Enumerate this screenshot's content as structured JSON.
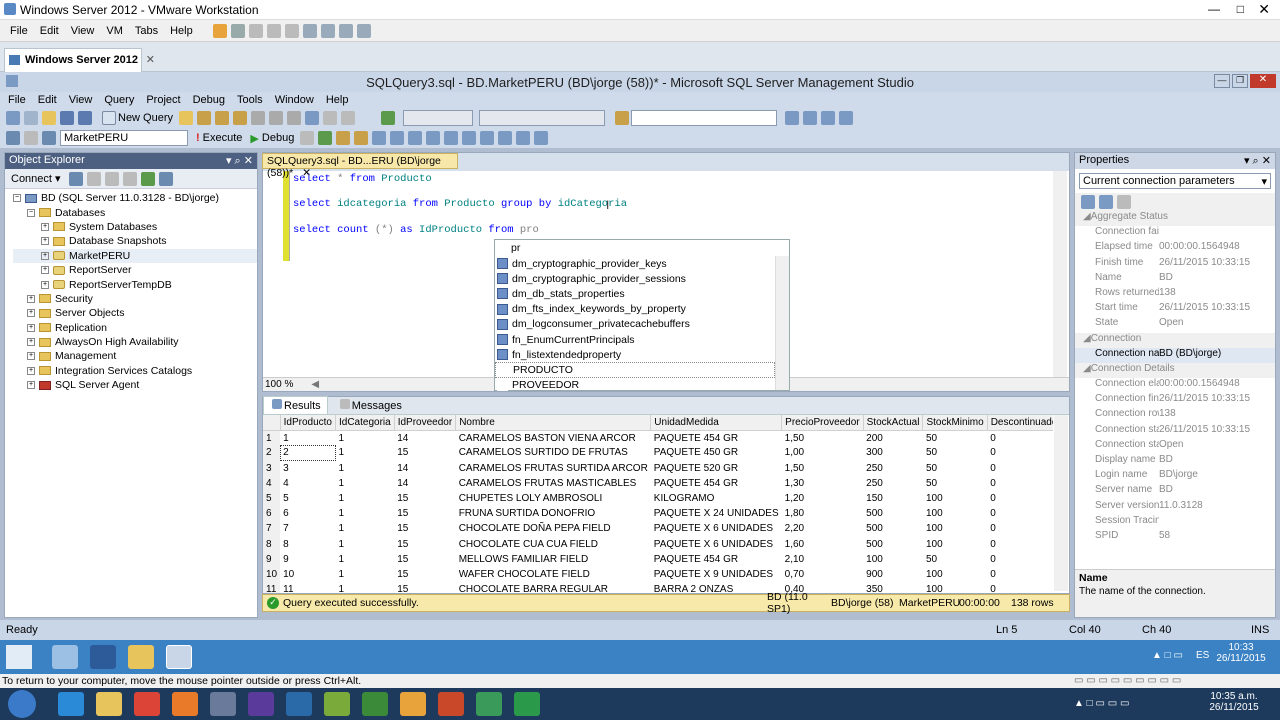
{
  "vmware": {
    "title": "Windows Server 2012 - VMware Workstation",
    "menu": [
      "File",
      "Edit",
      "View",
      "VM",
      "Tabs",
      "Help"
    ],
    "tab": "Windows Server 2012",
    "hint": "To return to your computer, move the mouse pointer outside or press Ctrl+Alt."
  },
  "ssms": {
    "title": "SQLQuery3.sql - BD.MarketPERU (BD\\jorge (58))* - Microsoft SQL Server Management Studio",
    "menu": [
      "File",
      "Edit",
      "View",
      "Query",
      "Project",
      "Debug",
      "Tools",
      "Window",
      "Help"
    ],
    "toolbar": {
      "new_query": "New Query",
      "database": "MarketPERU",
      "execute": "Execute",
      "debug": "Debug"
    }
  },
  "object_explorer": {
    "title": "Object Explorer",
    "connect": "Connect ▾",
    "tree": [
      {
        "level": 0,
        "label": "BD (SQL Server 11.0.3128 - BD\\jorge)",
        "exp": "−",
        "icon": "server"
      },
      {
        "level": 1,
        "label": "Databases",
        "exp": "−",
        "icon": "folder"
      },
      {
        "level": 2,
        "label": "System Databases",
        "exp": "+",
        "icon": "folder"
      },
      {
        "level": 2,
        "label": "Database Snapshots",
        "exp": "+",
        "icon": "folder"
      },
      {
        "level": 2,
        "label": "MarketPERU",
        "exp": "+",
        "icon": "db"
      },
      {
        "level": 2,
        "label": "ReportServer",
        "exp": "+",
        "icon": "db"
      },
      {
        "level": 2,
        "label": "ReportServerTempDB",
        "exp": "+",
        "icon": "db"
      },
      {
        "level": 1,
        "label": "Security",
        "exp": "+",
        "icon": "folder"
      },
      {
        "level": 1,
        "label": "Server Objects",
        "exp": "+",
        "icon": "folder"
      },
      {
        "level": 1,
        "label": "Replication",
        "exp": "+",
        "icon": "folder"
      },
      {
        "level": 1,
        "label": "AlwaysOn High Availability",
        "exp": "+",
        "icon": "folder"
      },
      {
        "level": 1,
        "label": "Management",
        "exp": "+",
        "icon": "folder"
      },
      {
        "level": 1,
        "label": "Integration Services Catalogs",
        "exp": "+",
        "icon": "folder"
      },
      {
        "level": 1,
        "label": "SQL Server Agent",
        "exp": "+",
        "icon": "agent"
      }
    ]
  },
  "editor": {
    "tab": "SQLQuery3.sql - BD...ERU (BD\\jorge (58))*",
    "zoom": "100 %",
    "line1": {
      "a": "select",
      "b": " * ",
      "c": "from",
      "d": " Producto"
    },
    "line2": {
      "a": "select",
      "b": " idcategoria ",
      "c": "from",
      "d": " Producto ",
      "e": "group by",
      "f": " idCategoria"
    },
    "line3": {
      "a": "select",
      "b": " count ",
      "c": "(*)",
      "d": " as ",
      "e": "IdProducto ",
      "f": "from",
      "g": " pro"
    },
    "autocomplete": {
      "typed": "pr",
      "items": [
        "dm_cryptographic_provider_keys",
        "dm_cryptographic_provider_sessions",
        "dm_db_stats_properties",
        "dm_fts_index_keywords_by_property",
        "dm_logconsumer_privatecachebuffers",
        "fn_EnumCurrentPrincipals",
        "fn_listextendedproperty",
        "PRODUCTO",
        "PROVEEDOR"
      ]
    }
  },
  "results": {
    "tabs": [
      "Results",
      "Messages"
    ],
    "columns": [
      "IdProducto",
      "IdCategoria",
      "IdProveedor",
      "Nombre",
      "UnidadMedida",
      "PrecioProveedor",
      "StockActual",
      "StockMinimo",
      "Descontinuado"
    ],
    "rows": [
      [
        "1",
        "1",
        "1",
        "14",
        "CARAMELOS BASTON VIENA ARCOR",
        "PAQUETE 454  GR",
        "1,50",
        "200",
        "50",
        "0"
      ],
      [
        "2",
        "2",
        "1",
        "15",
        "CARAMELOS SURTIDO DE FRUTAS",
        "PAQUETE 450  GR",
        "1,00",
        "300",
        "50",
        "0"
      ],
      [
        "3",
        "3",
        "1",
        "14",
        "CARAMELOS FRUTAS SURTIDA ARCOR",
        "PAQUETE 520  GR",
        "1,50",
        "250",
        "50",
        "0"
      ],
      [
        "4",
        "4",
        "1",
        "14",
        "CARAMELOS FRUTAS MASTICABLES",
        "PAQUETE 454  GR",
        "1,30",
        "250",
        "50",
        "0"
      ],
      [
        "5",
        "5",
        "1",
        "15",
        "CHUPETES LOLY   AMBROSOLI",
        "KILOGRAMO",
        "1,20",
        "150",
        "100",
        "0"
      ],
      [
        "6",
        "6",
        "1",
        "15",
        "FRUNA SURTIDA DONOFRIO",
        "PAQUETE X 24   UNIDADES",
        "1,80",
        "500",
        "100",
        "0"
      ],
      [
        "7",
        "7",
        "1",
        "15",
        "CHOCOLATE DOÑA PEPA FIELD",
        "PAQUETE X 6   UNIDADES",
        "2,20",
        "500",
        "100",
        "0"
      ],
      [
        "8",
        "8",
        "1",
        "15",
        "CHOCOLATE CUA CUA FIELD",
        "PAQUETE X 6   UNIDADES",
        "1,60",
        "500",
        "100",
        "0"
      ],
      [
        "9",
        "9",
        "1",
        "15",
        "MELLOWS FAMILIAR FIELD",
        "PAQUETE 454  GR",
        "2,10",
        "100",
        "50",
        "0"
      ],
      [
        "10",
        "10",
        "1",
        "15",
        "WAFER CHOCOLATE FIELD",
        "PAQUETE X 9   UNIDADES",
        "0,70",
        "900",
        "100",
        "0"
      ],
      [
        "11",
        "11",
        "1",
        "15",
        "CHOCOLATE BARRA REGULAR",
        "BARRA 2   ONZAS",
        "0,40",
        "350",
        "100",
        "0"
      ]
    ],
    "status": {
      "msg": "Query executed successfully.",
      "server": "BD (11.0 SP1)",
      "user": "BD\\jorge (58)",
      "db": "MarketPERU",
      "time": "00:00:00",
      "rows": "138 rows"
    }
  },
  "properties": {
    "title": "Properties",
    "selector": "Current connection parameters",
    "rows": [
      {
        "cat": "Aggregate Status"
      },
      {
        "k": "Connection failur",
        "v": ""
      },
      {
        "k": "Elapsed time",
        "v": "00:00:00.1564948"
      },
      {
        "k": "Finish time",
        "v": "26/11/2015 10:33:15"
      },
      {
        "k": "Name",
        "v": "BD"
      },
      {
        "k": "Rows returned",
        "v": "138"
      },
      {
        "k": "Start time",
        "v": "26/11/2015 10:33:15"
      },
      {
        "k": "State",
        "v": "Open"
      },
      {
        "cat": "Connection"
      },
      {
        "k": "Connection name",
        "v": "BD (BD\\jorge)",
        "sel": true
      },
      {
        "cat": "Connection Details"
      },
      {
        "k": "Connection elaps",
        "v": "00:00:00.1564948"
      },
      {
        "k": "Connection finish",
        "v": "26/11/2015 10:33:15"
      },
      {
        "k": "Connection rows",
        "v": "138"
      },
      {
        "k": "Connection start t",
        "v": "26/11/2015 10:33:15"
      },
      {
        "k": "Connection state",
        "v": "Open"
      },
      {
        "k": "Display name",
        "v": "BD"
      },
      {
        "k": "Login name",
        "v": "BD\\jorge"
      },
      {
        "k": "Server name",
        "v": "BD"
      },
      {
        "k": "Server version",
        "v": "11.0.3128"
      },
      {
        "k": "Session Tracing ID",
        "v": ""
      },
      {
        "k": "SPID",
        "v": "58"
      }
    ],
    "desc_title": "Name",
    "desc_text": "The name of the connection."
  },
  "statusbar": {
    "ready": "Ready",
    "ln": "Ln 5",
    "col": "Col 40",
    "ch": "Ch 40",
    "ins": "INS"
  },
  "server_taskbar": {
    "lang": "ES",
    "time": "10:33",
    "date": "26/11/2015"
  },
  "host_taskbar": {
    "time": "10:35 a.m.",
    "date": "26/11/2015"
  },
  "colors": {
    "ssms_bg": "#b0bcd0",
    "panel_head": "#4d6082",
    "keyword": "#0000ff",
    "table": "#008080",
    "status_ok": "#f6e9a9",
    "server_taskbar": "#3a82c4",
    "host_taskbar": "#1d3a5c"
  }
}
